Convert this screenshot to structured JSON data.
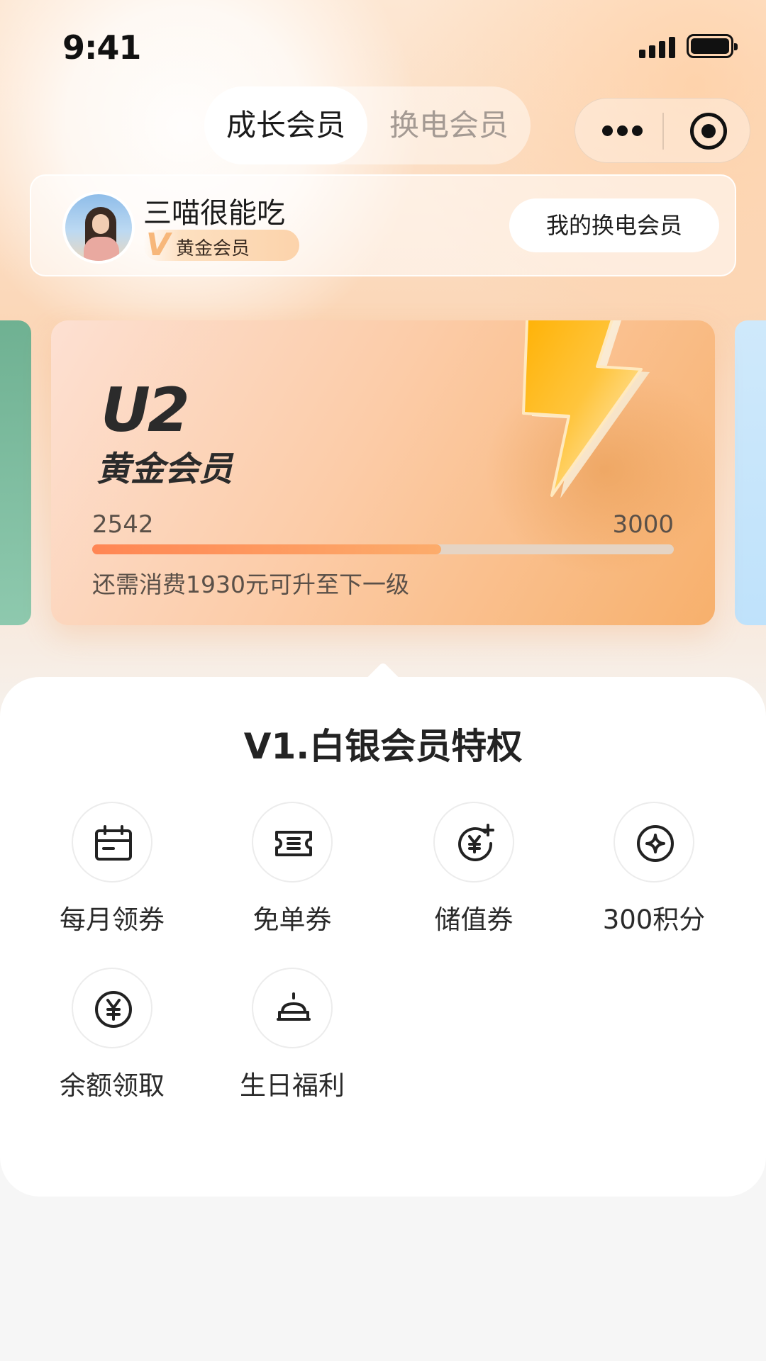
{
  "status_bar": {
    "time": "9:41",
    "signal_icon": "signal-bars-icon",
    "battery_icon": "battery-icon"
  },
  "tabs": [
    {
      "label": "成长会员",
      "active": true
    },
    {
      "label": "换电会员",
      "active": false
    }
  ],
  "capsule": {
    "more_icon": "more-dots-icon",
    "close_icon": "target-circle-icon"
  },
  "profile": {
    "username": "三喵很能吃",
    "level_badge": "黄金会员",
    "level_badge_icon": "V",
    "my_member_button": "我的换电会员"
  },
  "member_card": {
    "level_code": "U2",
    "level_name": "黄金会员",
    "current_points": "2542",
    "target_points": "3000",
    "progress_fraction": 0.6,
    "upgrade_hint": "还需消费1930元可升至下一级",
    "colors": {
      "accent": "#ff8654",
      "card_start": "#fde0d2",
      "card_end": "#f7b06c"
    }
  },
  "privileges": {
    "title": "V1.白银会员特权",
    "items": [
      {
        "label": "每月领券",
        "icon": "calendar-coupon-icon"
      },
      {
        "label": "免单券",
        "icon": "ticket-icon"
      },
      {
        "label": "储值券",
        "icon": "yuan-add-icon"
      },
      {
        "label": "300积分",
        "icon": "points-star-icon"
      },
      {
        "label": "余额领取",
        "icon": "yuan-coin-icon"
      },
      {
        "label": "生日福利",
        "icon": "birthday-cake-icon"
      }
    ]
  }
}
